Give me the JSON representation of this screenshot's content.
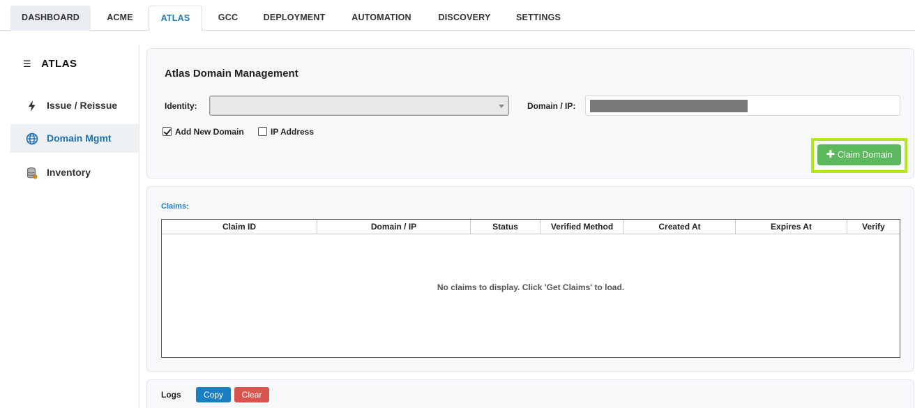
{
  "tabs": [
    {
      "label": "DASHBOARD"
    },
    {
      "label": "ACME"
    },
    {
      "label": "ATLAS"
    },
    {
      "label": "GCC"
    },
    {
      "label": "DEPLOYMENT"
    },
    {
      "label": "AUTOMATION"
    },
    {
      "label": "DISCOVERY"
    },
    {
      "label": "SETTINGS"
    }
  ],
  "active_tab": "ATLAS",
  "sidebar": {
    "title": "ATLAS",
    "items": [
      {
        "label": "Issue / Reissue",
        "icon": "lightning-icon"
      },
      {
        "label": "Domain Mgmt",
        "icon": "globe-icon",
        "active": true
      },
      {
        "label": "Inventory",
        "icon": "database-icon"
      }
    ]
  },
  "domain_panel": {
    "title": "Atlas Domain Management",
    "identity_label": "Identity:",
    "identity_value": "",
    "domain_label": "Domain / IP:",
    "domain_value": "",
    "add_new_domain_label": "Add New Domain",
    "add_new_domain_checked": true,
    "ip_address_label": "IP Address",
    "ip_address_checked": false,
    "claim_button_label": "Claim Domain"
  },
  "claims": {
    "label": "Claims:",
    "columns": [
      "Claim ID",
      "Domain / IP",
      "Status",
      "Verified Method",
      "Created At",
      "Expires At",
      "Verify"
    ],
    "rows": [],
    "empty_message": "No claims to display. Click 'Get Claims' to load."
  },
  "logs": {
    "label": "Logs",
    "copy_label": "Copy",
    "clear_label": "Clear"
  },
  "colors": {
    "accent": "#1f7ab8",
    "claim_button": "#5cb85c",
    "highlight": "#b5e61d",
    "copy_button": "#1a7fc1",
    "clear_button": "#d9534f"
  }
}
